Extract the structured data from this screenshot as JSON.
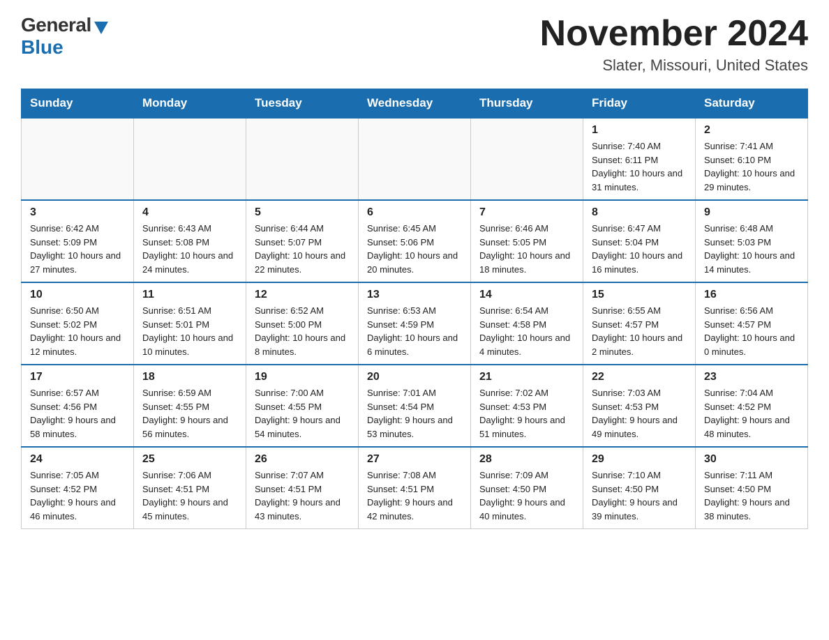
{
  "logo": {
    "general": "General",
    "blue": "Blue"
  },
  "header": {
    "month_title": "November 2024",
    "location": "Slater, Missouri, United States"
  },
  "calendar": {
    "days_of_week": [
      "Sunday",
      "Monday",
      "Tuesday",
      "Wednesday",
      "Thursday",
      "Friday",
      "Saturday"
    ],
    "weeks": [
      [
        {
          "day": "",
          "info": ""
        },
        {
          "day": "",
          "info": ""
        },
        {
          "day": "",
          "info": ""
        },
        {
          "day": "",
          "info": ""
        },
        {
          "day": "",
          "info": ""
        },
        {
          "day": "1",
          "info": "Sunrise: 7:40 AM\nSunset: 6:11 PM\nDaylight: 10 hours and 31 minutes."
        },
        {
          "day": "2",
          "info": "Sunrise: 7:41 AM\nSunset: 6:10 PM\nDaylight: 10 hours and 29 minutes."
        }
      ],
      [
        {
          "day": "3",
          "info": "Sunrise: 6:42 AM\nSunset: 5:09 PM\nDaylight: 10 hours and 27 minutes."
        },
        {
          "day": "4",
          "info": "Sunrise: 6:43 AM\nSunset: 5:08 PM\nDaylight: 10 hours and 24 minutes."
        },
        {
          "day": "5",
          "info": "Sunrise: 6:44 AM\nSunset: 5:07 PM\nDaylight: 10 hours and 22 minutes."
        },
        {
          "day": "6",
          "info": "Sunrise: 6:45 AM\nSunset: 5:06 PM\nDaylight: 10 hours and 20 minutes."
        },
        {
          "day": "7",
          "info": "Sunrise: 6:46 AM\nSunset: 5:05 PM\nDaylight: 10 hours and 18 minutes."
        },
        {
          "day": "8",
          "info": "Sunrise: 6:47 AM\nSunset: 5:04 PM\nDaylight: 10 hours and 16 minutes."
        },
        {
          "day": "9",
          "info": "Sunrise: 6:48 AM\nSunset: 5:03 PM\nDaylight: 10 hours and 14 minutes."
        }
      ],
      [
        {
          "day": "10",
          "info": "Sunrise: 6:50 AM\nSunset: 5:02 PM\nDaylight: 10 hours and 12 minutes."
        },
        {
          "day": "11",
          "info": "Sunrise: 6:51 AM\nSunset: 5:01 PM\nDaylight: 10 hours and 10 minutes."
        },
        {
          "day": "12",
          "info": "Sunrise: 6:52 AM\nSunset: 5:00 PM\nDaylight: 10 hours and 8 minutes."
        },
        {
          "day": "13",
          "info": "Sunrise: 6:53 AM\nSunset: 4:59 PM\nDaylight: 10 hours and 6 minutes."
        },
        {
          "day": "14",
          "info": "Sunrise: 6:54 AM\nSunset: 4:58 PM\nDaylight: 10 hours and 4 minutes."
        },
        {
          "day": "15",
          "info": "Sunrise: 6:55 AM\nSunset: 4:57 PM\nDaylight: 10 hours and 2 minutes."
        },
        {
          "day": "16",
          "info": "Sunrise: 6:56 AM\nSunset: 4:57 PM\nDaylight: 10 hours and 0 minutes."
        }
      ],
      [
        {
          "day": "17",
          "info": "Sunrise: 6:57 AM\nSunset: 4:56 PM\nDaylight: 9 hours and 58 minutes."
        },
        {
          "day": "18",
          "info": "Sunrise: 6:59 AM\nSunset: 4:55 PM\nDaylight: 9 hours and 56 minutes."
        },
        {
          "day": "19",
          "info": "Sunrise: 7:00 AM\nSunset: 4:55 PM\nDaylight: 9 hours and 54 minutes."
        },
        {
          "day": "20",
          "info": "Sunrise: 7:01 AM\nSunset: 4:54 PM\nDaylight: 9 hours and 53 minutes."
        },
        {
          "day": "21",
          "info": "Sunrise: 7:02 AM\nSunset: 4:53 PM\nDaylight: 9 hours and 51 minutes."
        },
        {
          "day": "22",
          "info": "Sunrise: 7:03 AM\nSunset: 4:53 PM\nDaylight: 9 hours and 49 minutes."
        },
        {
          "day": "23",
          "info": "Sunrise: 7:04 AM\nSunset: 4:52 PM\nDaylight: 9 hours and 48 minutes."
        }
      ],
      [
        {
          "day": "24",
          "info": "Sunrise: 7:05 AM\nSunset: 4:52 PM\nDaylight: 9 hours and 46 minutes."
        },
        {
          "day": "25",
          "info": "Sunrise: 7:06 AM\nSunset: 4:51 PM\nDaylight: 9 hours and 45 minutes."
        },
        {
          "day": "26",
          "info": "Sunrise: 7:07 AM\nSunset: 4:51 PM\nDaylight: 9 hours and 43 minutes."
        },
        {
          "day": "27",
          "info": "Sunrise: 7:08 AM\nSunset: 4:51 PM\nDaylight: 9 hours and 42 minutes."
        },
        {
          "day": "28",
          "info": "Sunrise: 7:09 AM\nSunset: 4:50 PM\nDaylight: 9 hours and 40 minutes."
        },
        {
          "day": "29",
          "info": "Sunrise: 7:10 AM\nSunset: 4:50 PM\nDaylight: 9 hours and 39 minutes."
        },
        {
          "day": "30",
          "info": "Sunrise: 7:11 AM\nSunset: 4:50 PM\nDaylight: 9 hours and 38 minutes."
        }
      ]
    ]
  }
}
